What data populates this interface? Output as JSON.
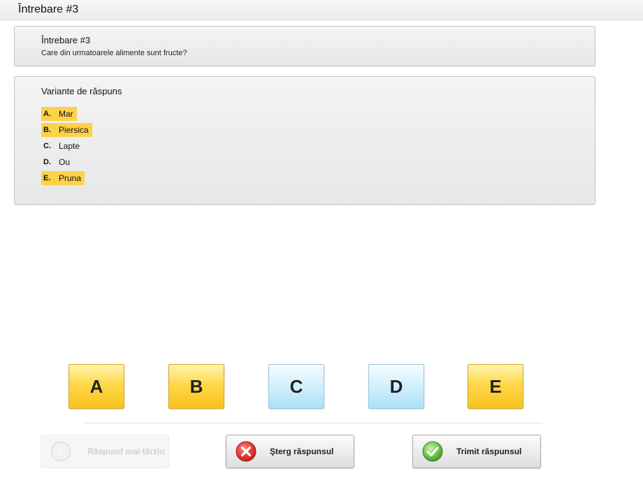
{
  "header": {
    "title": "Întrebare #3"
  },
  "question": {
    "title": "Întrebare #3",
    "text": "Care din urmatoarele alimente sunt fructe?"
  },
  "answers": {
    "title": "Variante de răspuns",
    "options": [
      {
        "letter": "A.",
        "text": "Mar",
        "selected": true
      },
      {
        "letter": "B.",
        "text": "Piersica",
        "selected": true
      },
      {
        "letter": "C.",
        "text": "Lapte",
        "selected": false
      },
      {
        "letter": "D.",
        "text": "Ou",
        "selected": false
      },
      {
        "letter": "E.",
        "text": "Pruna",
        "selected": true
      }
    ]
  },
  "answer_buttons": [
    {
      "label": "A",
      "selected": true
    },
    {
      "label": "B",
      "selected": true
    },
    {
      "label": "C",
      "selected": false
    },
    {
      "label": "D",
      "selected": false
    },
    {
      "label": "E",
      "selected": true
    }
  ],
  "actions": {
    "later": {
      "label": "Răspund mai târziu",
      "enabled": false,
      "icon": "clock-icon"
    },
    "clear": {
      "label": "Şterg răspunsul",
      "enabled": true,
      "icon": "close-circle-icon"
    },
    "submit": {
      "label": "Trimit răspunsul",
      "enabled": true,
      "icon": "checkmark-circle-icon"
    }
  },
  "colors": {
    "selected_highlight": "#fdd14a",
    "button_selected": "#ffd84a",
    "button_unselected": "#cdeefc",
    "clear_icon": "#e53935",
    "submit_icon": "#6cc24a"
  }
}
